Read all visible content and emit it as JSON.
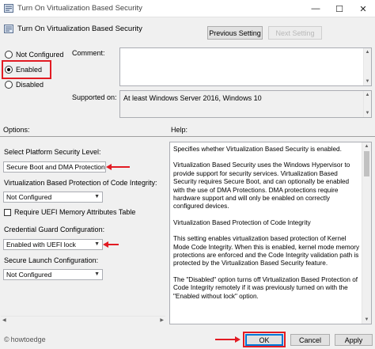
{
  "window": {
    "title": "Turn On Virtualization Based Security",
    "controls": {
      "minimize": "—",
      "maximize": "☐",
      "close": "✕"
    }
  },
  "header": {
    "setting_name": "Turn On Virtualization Based Security",
    "previous_label": "Previous Setting",
    "next_label": "Next Setting"
  },
  "state": {
    "options": [
      {
        "label": "Not Configured",
        "selected": false
      },
      {
        "label": "Enabled",
        "selected": true
      },
      {
        "label": "Disabled",
        "selected": false
      }
    ]
  },
  "comment": {
    "label": "Comment:",
    "value": ""
  },
  "supported": {
    "label": "Supported on:",
    "value": "At least Windows Server 2016, Windows 10"
  },
  "options_label": "Options:",
  "help_label": "Help:",
  "options": {
    "platform_label": "Select Platform Security Level:",
    "platform_value": "Secure Boot and DMA Protection",
    "vbs_code_integrity_label": "Virtualization Based Protection of Code Integrity:",
    "vbs_code_integrity_value": "Not Configured",
    "uefi_table_label": "Require UEFI Memory Attributes Table",
    "credential_guard_label": "Credential Guard Configuration:",
    "credential_guard_value": "Enabled with UEFI lock",
    "secure_launch_label": "Secure Launch Configuration:",
    "secure_launch_value": "Not Configured"
  },
  "help": {
    "paragraphs": [
      "Specifies whether Virtualization Based Security is enabled.",
      "Virtualization Based Security uses the Windows Hypervisor to provide support for security services. Virtualization Based Security requires Secure Boot, and can optionally be enabled with the use of DMA Protections. DMA protections require hardware support and will only be enabled on correctly configured devices.",
      "Virtualization Based Protection of Code Integrity",
      "This setting enables virtualization based protection of Kernel Mode Code Integrity. When this is enabled, kernel mode memory protections are enforced and the Code Integrity validation path is protected by the Virtualization Based Security feature.",
      "The \"Disabled\" option turns off Virtualization Based Protection of Code Integrity remotely if it was previously turned on with the \"Enabled without lock\" option."
    ]
  },
  "footer": {
    "ok_label": "OK",
    "cancel_label": "Cancel",
    "apply_label": "Apply"
  },
  "watermark": "howtoedge",
  "colors": {
    "annotation_red": "#e21b23",
    "focus_blue": "#0078d7"
  }
}
